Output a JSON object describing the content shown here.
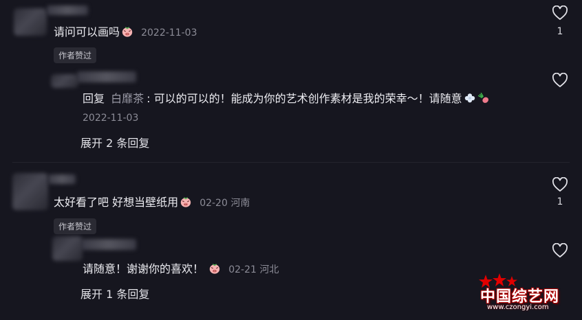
{
  "comments": [
    {
      "text": "请问可以画吗",
      "date": "2022-11-03",
      "badge": "作者赞过",
      "likes": "1",
      "reply": {
        "prefix": "回复",
        "reply_to": "白靡茶",
        "text": ": 可以的可以的！能成为你的艺术创作素材是我的荣幸～！请随意",
        "date": "2022-11-03",
        "expand": "展开 2 条回复"
      }
    },
    {
      "text": "太好看了吧 好想当壁纸用",
      "date": "02-20 河南",
      "badge": "作者赞过",
      "likes": "1",
      "reply": {
        "text": "请随意！谢谢你的喜欢！",
        "date": "02-21 河北",
        "expand": "展开 1 条回复"
      }
    }
  ],
  "watermark": {
    "title": "中国综艺网",
    "url": "www.czongyi.com"
  },
  "icons": {
    "heart": "heart-outline-icon",
    "emoji": "pig-face-emoji-icon",
    "flower": "flower-emoji-icon",
    "radish": "radish-emoji-icon"
  },
  "colors": {
    "background": "#16161f",
    "text": "#ededf2",
    "muted": "#8c8c97",
    "badge_bg": "#2a2a33",
    "watermark_red": "#d40000"
  }
}
